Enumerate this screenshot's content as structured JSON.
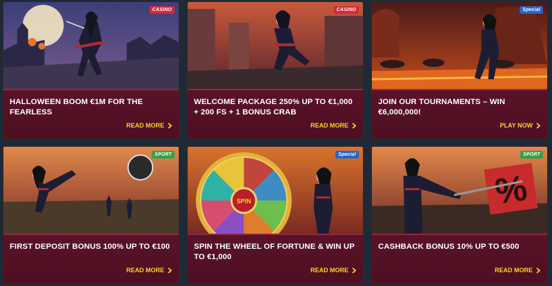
{
  "colors": {
    "card_bg": "#5e1429",
    "cta": "#ffd21f",
    "casino": "#d7283a",
    "special": "#2563c9",
    "sport": "#2fa34a"
  },
  "cards": [
    {
      "badge": "CASINO",
      "title": "HALLOWEEN BOOM €1M FOR THE FEARLESS",
      "cta": "READ MORE",
      "art": "halloween-rooftop"
    },
    {
      "badge": "CASINO",
      "title": "WELCOME PACKAGE 250% UP TO €1,000 + 200 FS + 1 BONUS CRAB",
      "cta": "READ MORE",
      "art": "ninja-city"
    },
    {
      "badge": "Special",
      "title": "JOIN OUR TOURNAMENTS – WIN €6,000,000!",
      "cta": "PLAY NOW",
      "art": "fire-hall"
    },
    {
      "badge": "SPORT",
      "title": "FIRST DEPOSIT BONUS 100% UP TO €100",
      "cta": "READ MORE",
      "art": "stadium-kick"
    },
    {
      "badge": "Special",
      "title": "SPIN THE WHEEL OF FORTUNE & WIN UP TO €1,000",
      "cta": "READ MORE",
      "art": "fortune-wheel",
      "wheel_label": "SPIN"
    },
    {
      "badge": "SPORT",
      "title": "CASHBACK BONUS 10% UP TO €500",
      "cta": "READ MORE",
      "art": "cashback-percent",
      "sign_text": "%"
    }
  ]
}
